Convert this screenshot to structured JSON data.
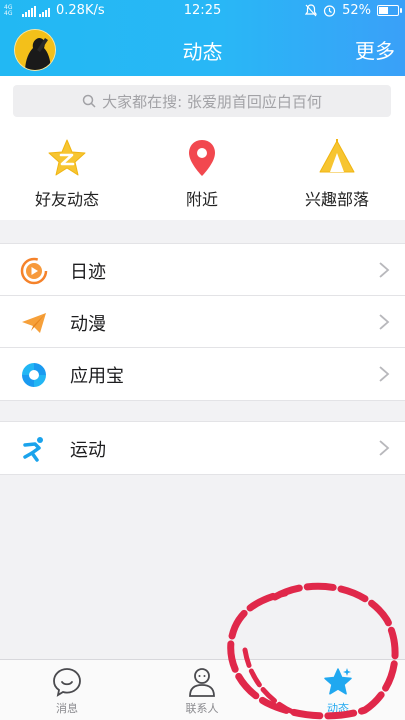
{
  "status_bar": {
    "net_label": "4G 4G",
    "speed": "0.28K/s",
    "time": "12:25",
    "battery": "52%",
    "battery_level": 0.52
  },
  "header": {
    "title": "动态",
    "more_label": "更多"
  },
  "search": {
    "placeholder": "大家都在搜: 张爱朋首回应白百何"
  },
  "quick_actions": [
    {
      "label": "好友动态",
      "icon": "friends-feed-star-icon"
    },
    {
      "label": "附近",
      "icon": "location-pin-icon"
    },
    {
      "label": "兴趣部落",
      "icon": "tent-icon"
    }
  ],
  "list_group_1": [
    {
      "label": "日迹",
      "icon": "play-circle-icon"
    },
    {
      "label": "动漫",
      "icon": "paper-plane-icon"
    },
    {
      "label": "应用宝",
      "icon": "app-store-icon"
    }
  ],
  "list_group_2": [
    {
      "label": "运动",
      "icon": "running-icon"
    }
  ],
  "tabs": [
    {
      "label": "消息",
      "icon": "message-bubble-icon"
    },
    {
      "label": "联系人",
      "icon": "contacts-icon"
    },
    {
      "label": "动态",
      "icon": "star-icon"
    }
  ],
  "colors": {
    "accent": "#20a8f0",
    "annotation": "#e0284a"
  }
}
